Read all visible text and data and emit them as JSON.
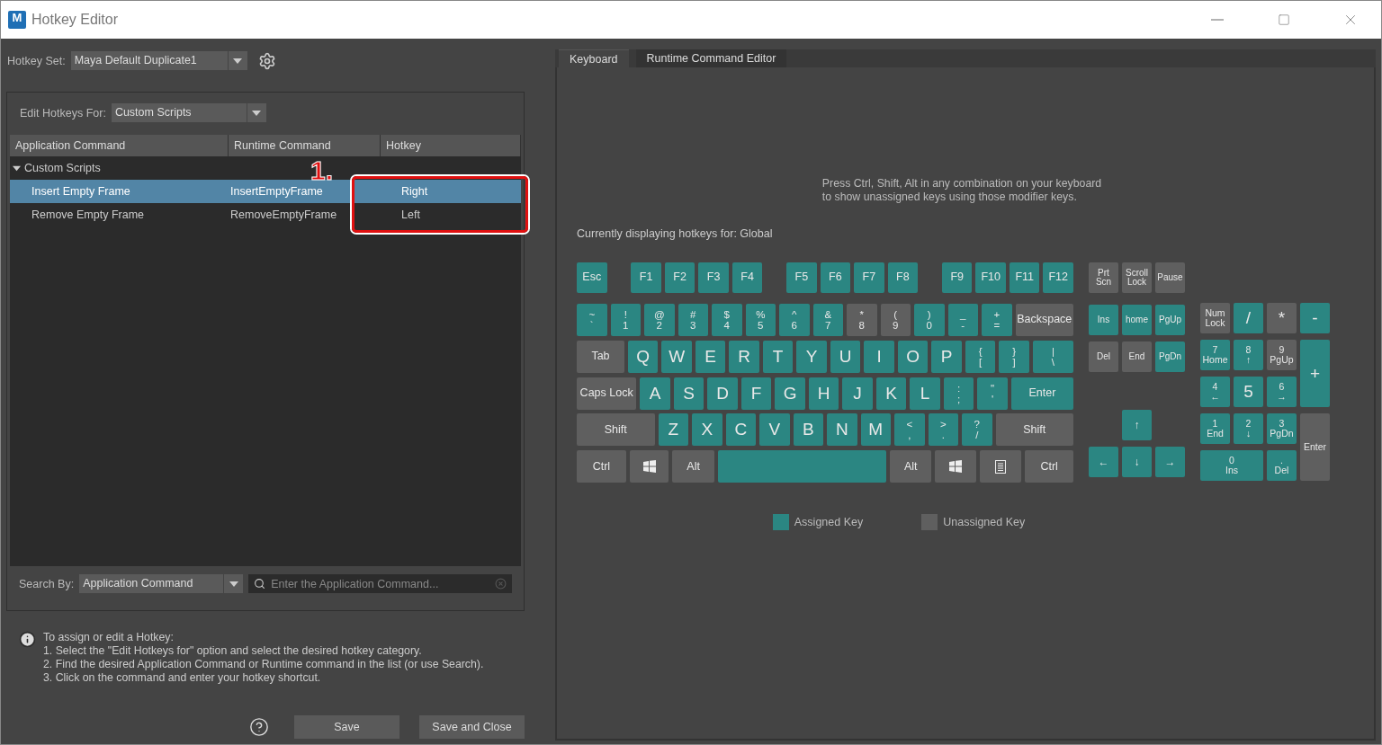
{
  "window": {
    "title": "Hotkey Editor",
    "app_icon": "M"
  },
  "hotkey_set": {
    "label": "Hotkey Set:",
    "value": "Maya Default Duplicate1"
  },
  "edit_hotkeys_for": {
    "label": "Edit Hotkeys For:",
    "value": "Custom Scripts"
  },
  "table": {
    "columns": [
      "Application Command",
      "Runtime Command",
      "Hotkey"
    ],
    "groups": [
      {
        "name": "Custom Scripts",
        "expanded": true,
        "rows": [
          {
            "command": "Insert Empty Frame",
            "runtime": "InsertEmptyFrame",
            "hotkey": "Right",
            "selected": true
          },
          {
            "command": "Remove Empty Frame",
            "runtime": "RemoveEmptyFrame",
            "hotkey": "Left",
            "selected": false
          }
        ]
      }
    ]
  },
  "annotation": {
    "label": "1."
  },
  "search": {
    "label": "Search By:",
    "mode": "Application Command",
    "placeholder": "Enter the Application Command..."
  },
  "info": {
    "heading": "To assign or edit a Hotkey:",
    "steps": [
      "1. Select the \"Edit Hotkeys for\" option and select the desired hotkey category.",
      "2. Find the desired Application Command or Runtime command in the list (or use Search).",
      "3. Click on the command and enter your hotkey shortcut."
    ]
  },
  "buttons": [
    "Save",
    "Save and Close"
  ],
  "tabs": [
    {
      "label": "Keyboard",
      "selected": true
    },
    {
      "label": "Runtime Command Editor",
      "selected": false
    }
  ],
  "hint": [
    "Press Ctrl, Shift, Alt in any combination on your keyboard",
    "to show unassigned keys using those modifier keys."
  ],
  "displaying": "Currently displaying hotkeys for: Global",
  "function_keys": [
    [
      {
        "label": "Esc",
        "assigned": true
      }
    ],
    [
      {
        "label": "F1",
        "assigned": true
      },
      {
        "label": "F2",
        "assigned": true
      },
      {
        "label": "F3",
        "assigned": true
      },
      {
        "label": "F4",
        "assigned": true
      }
    ],
    [
      {
        "label": "F5",
        "assigned": true
      },
      {
        "label": "F6",
        "assigned": true
      },
      {
        "label": "F7",
        "assigned": true
      },
      {
        "label": "F8",
        "assigned": true
      }
    ],
    [
      {
        "label": "F9",
        "assigned": true
      },
      {
        "label": "F10",
        "assigned": true
      },
      {
        "label": "F11",
        "assigned": true
      },
      {
        "label": "F12",
        "assigned": true
      }
    ]
  ],
  "main_rows": [
    [
      {
        "label": "~",
        "sub": "`",
        "assigned": true
      },
      {
        "label": "!",
        "sub": "1",
        "assigned": true
      },
      {
        "label": "@",
        "sub": "2",
        "assigned": true
      },
      {
        "label": "#",
        "sub": "3",
        "assigned": true
      },
      {
        "label": "$",
        "sub": "4",
        "assigned": true
      },
      {
        "label": "%",
        "sub": "5",
        "assigned": true
      },
      {
        "label": "^",
        "sub": "6",
        "assigned": true
      },
      {
        "label": "&",
        "sub": "7",
        "assigned": true
      },
      {
        "label": "*",
        "sub": "8",
        "assigned": false
      },
      {
        "label": "(",
        "sub": "9",
        "assigned": false
      },
      {
        "label": ")",
        "sub": "0",
        "assigned": true
      },
      {
        "label": "_",
        "sub": "-",
        "assigned": true
      },
      {
        "label": "+",
        "sub": "=",
        "assigned": true
      },
      {
        "label": "Backspace",
        "assigned": false
      }
    ],
    [
      {
        "label": "Tab",
        "assigned": false
      },
      {
        "label": "Q",
        "assigned": true
      },
      {
        "label": "W",
        "assigned": true
      },
      {
        "label": "E",
        "assigned": true
      },
      {
        "label": "R",
        "assigned": true
      },
      {
        "label": "T",
        "assigned": true
      },
      {
        "label": "Y",
        "assigned": true
      },
      {
        "label": "U",
        "assigned": true
      },
      {
        "label": "I",
        "assigned": true
      },
      {
        "label": "O",
        "assigned": true
      },
      {
        "label": "P",
        "assigned": true
      },
      {
        "label": "{",
        "sub": "[",
        "assigned": true
      },
      {
        "label": "}",
        "sub": "]",
        "assigned": true
      },
      {
        "label": "|",
        "sub": "\\",
        "assigned": true
      }
    ],
    [
      {
        "label": "Caps Lock",
        "assigned": false
      },
      {
        "label": "A",
        "assigned": true
      },
      {
        "label": "S",
        "assigned": true
      },
      {
        "label": "D",
        "assigned": true
      },
      {
        "label": "F",
        "assigned": true
      },
      {
        "label": "G",
        "assigned": true
      },
      {
        "label": "H",
        "assigned": true
      },
      {
        "label": "J",
        "assigned": true
      },
      {
        "label": "K",
        "assigned": true
      },
      {
        "label": "L",
        "assigned": true
      },
      {
        "label": ":",
        "sub": ";",
        "assigned": true
      },
      {
        "label": "\"",
        "sub": "'",
        "assigned": true
      },
      {
        "label": "Enter",
        "assigned": true
      }
    ],
    [
      {
        "label": "Shift",
        "assigned": false
      },
      {
        "label": "Z",
        "assigned": true
      },
      {
        "label": "X",
        "assigned": true
      },
      {
        "label": "C",
        "assigned": true
      },
      {
        "label": "V",
        "assigned": true
      },
      {
        "label": "B",
        "assigned": true
      },
      {
        "label": "N",
        "assigned": true
      },
      {
        "label": "M",
        "assigned": true
      },
      {
        "label": "<",
        "sub": ",",
        "assigned": true
      },
      {
        "label": ">",
        "sub": ".",
        "assigned": true
      },
      {
        "label": "?",
        "sub": "/",
        "assigned": true
      },
      {
        "label": "Shift",
        "assigned": false
      }
    ],
    [
      {
        "label": "Ctrl",
        "assigned": false
      },
      {
        "kind": "windows",
        "assigned": false
      },
      {
        "label": "Alt",
        "assigned": false
      },
      {
        "kind": "space",
        "assigned": true
      },
      {
        "label": "Alt",
        "assigned": false
      },
      {
        "kind": "windows",
        "assigned": false
      },
      {
        "kind": "menu",
        "assigned": false
      },
      {
        "label": "Ctrl",
        "assigned": false
      }
    ]
  ],
  "system_keys": [
    {
      "label": "Prt",
      "sub": "Scn",
      "assigned": false
    },
    {
      "label": "Scroll",
      "sub": "Lock",
      "assigned": false
    },
    {
      "label": "Pause",
      "assigned": false
    }
  ],
  "edit_keys": [
    {
      "label": "Ins",
      "assigned": true
    },
    {
      "label": "home",
      "assigned": true
    },
    {
      "label": "PgUp",
      "assigned": true
    },
    {
      "label": "Del",
      "assigned": false
    },
    {
      "label": "End",
      "assigned": false
    },
    {
      "label": "PgDn",
      "assigned": true
    }
  ],
  "arrow_keys": [
    {
      "label": "↑",
      "assigned": true
    },
    {
      "label": "←",
      "assigned": true
    },
    {
      "label": "↓",
      "assigned": true
    },
    {
      "label": "→",
      "assigned": true
    }
  ],
  "numpad": [
    {
      "label": "Num",
      "sub": "Lock",
      "assigned": false
    },
    {
      "label": "/",
      "assigned": true
    },
    {
      "label": "*",
      "assigned": false
    },
    {
      "label": "-",
      "assigned": true
    },
    {
      "label": "7",
      "sub": "Home",
      "assigned": true
    },
    {
      "label": "8",
      "sub": "↑",
      "assigned": true
    },
    {
      "label": "9",
      "sub": "PgUp",
      "assigned": false
    },
    {
      "label": "+",
      "kind": "tall",
      "assigned": true
    },
    {
      "label": "4",
      "sub": "←",
      "assigned": true
    },
    {
      "label": "5",
      "assigned": true
    },
    {
      "label": "6",
      "sub": "→",
      "assigned": true
    },
    {
      "label": "1",
      "sub": "End",
      "assigned": true
    },
    {
      "label": "2",
      "sub": "↓",
      "assigned": true
    },
    {
      "label": "3",
      "sub": "PgDn",
      "assigned": true
    },
    {
      "label": "Enter",
      "kind": "tall",
      "assigned": false
    },
    {
      "label": "0",
      "sub": "Ins",
      "kind": "wide",
      "assigned": true
    },
    {
      "label": ".",
      "sub": "Del",
      "assigned": true
    }
  ],
  "legend": [
    {
      "label": "Assigned Key",
      "assigned": true
    },
    {
      "label": "Unassigned Key",
      "assigned": false
    }
  ]
}
